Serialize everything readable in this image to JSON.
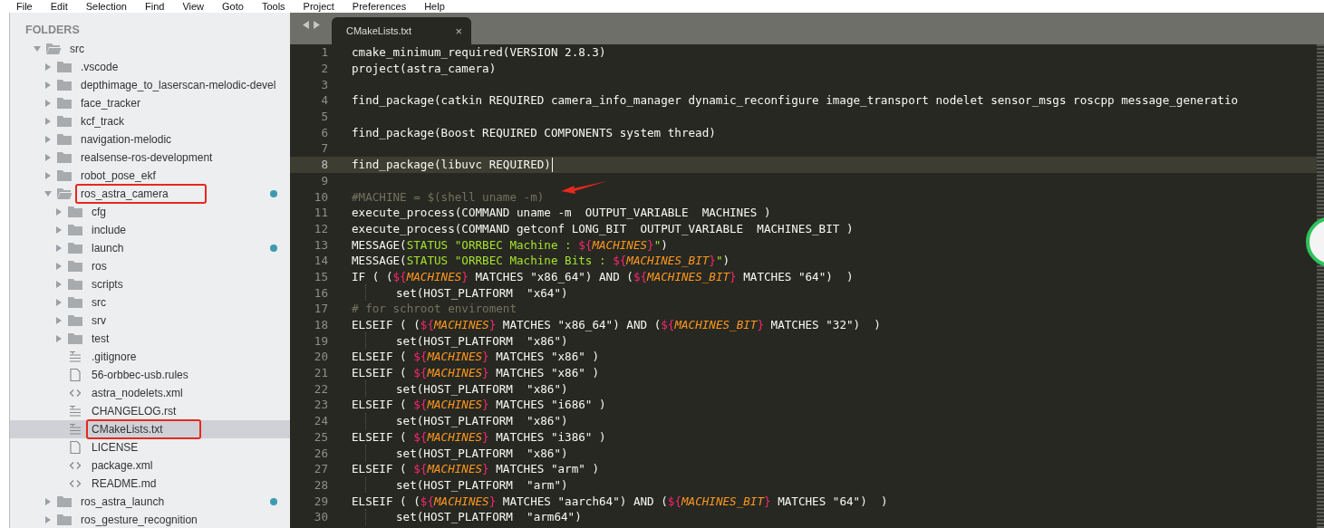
{
  "menu": [
    "File",
    "Edit",
    "Selection",
    "Find",
    "View",
    "Goto",
    "Tools",
    "Project",
    "Preferences",
    "Help"
  ],
  "sidebar": {
    "title": "FOLDERS",
    "tree": [
      {
        "name": "src",
        "kind": "folder",
        "expanded": true,
        "selected": false,
        "modified": false,
        "annotated": false,
        "children": [
          {
            "name": ".vscode",
            "kind": "folder",
            "expanded": false,
            "selected": false,
            "modified": false,
            "annotated": false
          },
          {
            "name": "depthimage_to_laserscan-melodic-devel",
            "kind": "folder",
            "expanded": false,
            "selected": false,
            "modified": false,
            "annotated": false
          },
          {
            "name": "face_tracker",
            "kind": "folder",
            "expanded": false,
            "selected": false,
            "modified": false,
            "annotated": false
          },
          {
            "name": "kcf_track",
            "kind": "folder",
            "expanded": false,
            "selected": false,
            "modified": false,
            "annotated": false
          },
          {
            "name": "navigation-melodic",
            "kind": "folder",
            "expanded": false,
            "selected": false,
            "modified": false,
            "annotated": false
          },
          {
            "name": "realsense-ros-development",
            "kind": "folder",
            "expanded": false,
            "selected": false,
            "modified": false,
            "annotated": false
          },
          {
            "name": "robot_pose_ekf",
            "kind": "folder",
            "expanded": false,
            "selected": false,
            "modified": false,
            "annotated": false
          },
          {
            "name": "ros_astra_camera",
            "kind": "folder",
            "expanded": true,
            "selected": false,
            "modified": true,
            "annotated": true,
            "children": [
              {
                "name": "cfg",
                "kind": "folder",
                "expanded": false,
                "selected": false,
                "modified": false,
                "annotated": false
              },
              {
                "name": "include",
                "kind": "folder",
                "expanded": false,
                "selected": false,
                "modified": false,
                "annotated": false
              },
              {
                "name": "launch",
                "kind": "folder",
                "expanded": false,
                "selected": false,
                "modified": true,
                "annotated": false
              },
              {
                "name": "ros",
                "kind": "folder",
                "expanded": false,
                "selected": false,
                "modified": false,
                "annotated": false
              },
              {
                "name": "scripts",
                "kind": "folder",
                "expanded": false,
                "selected": false,
                "modified": false,
                "annotated": false
              },
              {
                "name": "src",
                "kind": "folder",
                "expanded": false,
                "selected": false,
                "modified": false,
                "annotated": false
              },
              {
                "name": "srv",
                "kind": "folder",
                "expanded": false,
                "selected": false,
                "modified": false,
                "annotated": false
              },
              {
                "name": "test",
                "kind": "folder",
                "expanded": false,
                "selected": false,
                "modified": false,
                "annotated": false
              },
              {
                "name": ".gitignore",
                "kind": "text",
                "selected": false,
                "modified": false,
                "annotated": false
              },
              {
                "name": "56-orbbec-usb.rules",
                "kind": "doc",
                "selected": false,
                "modified": false,
                "annotated": false
              },
              {
                "name": "astra_nodelets.xml",
                "kind": "code",
                "selected": false,
                "modified": false,
                "annotated": false
              },
              {
                "name": "CHANGELOG.rst",
                "kind": "text",
                "selected": false,
                "modified": false,
                "annotated": false
              },
              {
                "name": "CMakeLists.txt",
                "kind": "text",
                "selected": true,
                "modified": false,
                "annotated": true
              },
              {
                "name": "LICENSE",
                "kind": "doc",
                "selected": false,
                "modified": false,
                "annotated": false
              },
              {
                "name": "package.xml",
                "kind": "code",
                "selected": false,
                "modified": false,
                "annotated": false
              },
              {
                "name": "README.md",
                "kind": "code",
                "selected": false,
                "modified": false,
                "annotated": false
              }
            ]
          },
          {
            "name": "ros_astra_launch",
            "kind": "folder",
            "expanded": false,
            "selected": false,
            "modified": true,
            "annotated": false
          },
          {
            "name": "ros_gesture_recognition",
            "kind": "folder",
            "expanded": false,
            "selected": false,
            "modified": false,
            "annotated": false
          }
        ]
      }
    ]
  },
  "tabs": [
    {
      "label": "CMakeLists.txt",
      "close": "×",
      "selected": true
    }
  ],
  "editor": {
    "lines": [
      {
        "num": "1",
        "current": false,
        "indented": false,
        "tokens": [
          {
            "kind": "plain",
            "text": "cmake_minimum_required(VERSION 2.8.3)"
          }
        ]
      },
      {
        "num": "2",
        "current": false,
        "indented": false,
        "tokens": [
          {
            "kind": "plain",
            "text": "project(astra_camera)"
          }
        ]
      },
      {
        "num": "3",
        "current": false,
        "indented": false
      },
      {
        "num": "4",
        "current": false,
        "indented": false,
        "tokens": [
          {
            "kind": "plain",
            "text": "find_package(catkin REQUIRED camera_info_manager dynamic_reconfigure image_transport nodelet sensor_msgs roscpp message_generatio"
          }
        ]
      },
      {
        "num": "5",
        "current": false,
        "indented": false
      },
      {
        "num": "6",
        "current": false,
        "indented": false,
        "tokens": [
          {
            "kind": "plain",
            "text": "find_package(Boost REQUIRED COMPONENTS system thread)"
          }
        ]
      },
      {
        "num": "7",
        "current": false,
        "indented": false
      },
      {
        "num": "8",
        "current": true,
        "indented": false,
        "tokens": [
          {
            "kind": "plain",
            "text": "find_package(libuvc REQUIRED)"
          }
        ]
      },
      {
        "num": "9",
        "current": false,
        "indented": false
      },
      {
        "num": "10",
        "current": false,
        "indented": false,
        "tokens": [
          {
            "kind": "comment",
            "text": "#MACHINE = $(shell uname -m)"
          }
        ]
      },
      {
        "num": "11",
        "current": false,
        "indented": false,
        "tokens": [
          {
            "kind": "plain",
            "text": "execute_process(COMMAND uname -m  OUTPUT_VARIABLE  MACHINES )"
          }
        ]
      },
      {
        "num": "12",
        "current": false,
        "indented": false,
        "tokens": [
          {
            "kind": "plain",
            "text": "execute_process(COMMAND getconf LONG_BIT  OUTPUT_VARIABLE  MACHINES_BIT )"
          }
        ]
      },
      {
        "num": "13",
        "current": false,
        "indented": false,
        "tokens": [
          {
            "kind": "plain",
            "text": "MESSAGE("
          },
          {
            "kind": "string",
            "text": "STATUS \"ORRBEC Machine : "
          },
          {
            "kind": "punct",
            "text": "${"
          },
          {
            "kind": "var",
            "text": "MACHINES"
          },
          {
            "kind": "punct",
            "text": "}"
          },
          {
            "kind": "string",
            "text": "\""
          },
          {
            "kind": "plain",
            "text": ")"
          }
        ]
      },
      {
        "num": "14",
        "current": false,
        "indented": false,
        "tokens": [
          {
            "kind": "plain",
            "text": "MESSAGE("
          },
          {
            "kind": "string",
            "text": "STATUS \"ORRBEC Machine Bits : "
          },
          {
            "kind": "punct",
            "text": "${"
          },
          {
            "kind": "var",
            "text": "MACHINES_BIT"
          },
          {
            "kind": "punct",
            "text": "}"
          },
          {
            "kind": "string",
            "text": "\""
          },
          {
            "kind": "plain",
            "text": ")"
          }
        ]
      },
      {
        "num": "15",
        "current": false,
        "indented": false,
        "tokens": [
          {
            "kind": "plain",
            "text": "IF ( ("
          },
          {
            "kind": "punct",
            "text": "${"
          },
          {
            "kind": "var",
            "text": "MACHINES"
          },
          {
            "kind": "punct",
            "text": "}"
          },
          {
            "kind": "plain",
            "text": " MATCHES \"x86_64\") AND ("
          },
          {
            "kind": "punct",
            "text": "${"
          },
          {
            "kind": "var",
            "text": "MACHINES_BIT"
          },
          {
            "kind": "punct",
            "text": "}"
          },
          {
            "kind": "plain",
            "text": " MATCHES \"64\")  )"
          }
        ]
      },
      {
        "num": "16",
        "current": false,
        "indented": true,
        "tokens": [
          {
            "kind": "plain",
            "text": "set(HOST_PLATFORM  \"x64\")"
          }
        ]
      },
      {
        "num": "17",
        "current": false,
        "indented": false,
        "tokens": [
          {
            "kind": "comment",
            "text": "# for schroot enviroment"
          }
        ]
      },
      {
        "num": "18",
        "current": false,
        "indented": false,
        "tokens": [
          {
            "kind": "plain",
            "text": "ELSEIF ( ("
          },
          {
            "kind": "punct",
            "text": "${"
          },
          {
            "kind": "var",
            "text": "MACHINES"
          },
          {
            "kind": "punct",
            "text": "}"
          },
          {
            "kind": "plain",
            "text": " MATCHES \"x86_64\") AND ("
          },
          {
            "kind": "punct",
            "text": "${"
          },
          {
            "kind": "var",
            "text": "MACHINES_BIT"
          },
          {
            "kind": "punct",
            "text": "}"
          },
          {
            "kind": "plain",
            "text": " MATCHES \"32\")  )"
          }
        ]
      },
      {
        "num": "19",
        "current": false,
        "indented": true,
        "tokens": [
          {
            "kind": "plain",
            "text": "set(HOST_PLATFORM  \"x86\")"
          }
        ]
      },
      {
        "num": "20",
        "current": false,
        "indented": false,
        "tokens": [
          {
            "kind": "plain",
            "text": "ELSEIF ( "
          },
          {
            "kind": "punct",
            "text": "${"
          },
          {
            "kind": "var",
            "text": "MACHINES"
          },
          {
            "kind": "punct",
            "text": "}"
          },
          {
            "kind": "plain",
            "text": " MATCHES \"x86\" )"
          }
        ]
      },
      {
        "num": "21",
        "current": false,
        "indented": false,
        "tokens": [
          {
            "kind": "plain",
            "text": "ELSEIF ( "
          },
          {
            "kind": "punct",
            "text": "${"
          },
          {
            "kind": "var",
            "text": "MACHINES"
          },
          {
            "kind": "punct",
            "text": "}"
          },
          {
            "kind": "plain",
            "text": " MATCHES \"x86\" )"
          }
        ]
      },
      {
        "num": "22",
        "current": false,
        "indented": true,
        "tokens": [
          {
            "kind": "plain",
            "text": "set(HOST_PLATFORM  \"x86\")"
          }
        ]
      },
      {
        "num": "23",
        "current": false,
        "indented": false,
        "tokens": [
          {
            "kind": "plain",
            "text": "ELSEIF ( "
          },
          {
            "kind": "punct",
            "text": "${"
          },
          {
            "kind": "var",
            "text": "MACHINES"
          },
          {
            "kind": "punct",
            "text": "}"
          },
          {
            "kind": "plain",
            "text": " MATCHES \"i686\" )"
          }
        ]
      },
      {
        "num": "24",
        "current": false,
        "indented": true,
        "tokens": [
          {
            "kind": "plain",
            "text": "set(HOST_PLATFORM  \"x86\")"
          }
        ]
      },
      {
        "num": "25",
        "current": false,
        "indented": false,
        "tokens": [
          {
            "kind": "plain",
            "text": "ELSEIF ( "
          },
          {
            "kind": "punct",
            "text": "${"
          },
          {
            "kind": "var",
            "text": "MACHINES"
          },
          {
            "kind": "punct",
            "text": "}"
          },
          {
            "kind": "plain",
            "text": " MATCHES \"i386\" )"
          }
        ]
      },
      {
        "num": "26",
        "current": false,
        "indented": true,
        "tokens": [
          {
            "kind": "plain",
            "text": "set(HOST_PLATFORM  \"x86\")"
          }
        ]
      },
      {
        "num": "27",
        "current": false,
        "indented": false,
        "tokens": [
          {
            "kind": "plain",
            "text": "ELSEIF ( "
          },
          {
            "kind": "punct",
            "text": "${"
          },
          {
            "kind": "var",
            "text": "MACHINES"
          },
          {
            "kind": "punct",
            "text": "}"
          },
          {
            "kind": "plain",
            "text": " MATCHES \"arm\" )"
          }
        ]
      },
      {
        "num": "28",
        "current": false,
        "indented": true,
        "tokens": [
          {
            "kind": "plain",
            "text": "set(HOST_PLATFORM  \"arm\")"
          }
        ]
      },
      {
        "num": "29",
        "current": false,
        "indented": false,
        "tokens": [
          {
            "kind": "plain",
            "text": "ELSEIF ( ("
          },
          {
            "kind": "punct",
            "text": "${"
          },
          {
            "kind": "var",
            "text": "MACHINES"
          },
          {
            "kind": "punct",
            "text": "}"
          },
          {
            "kind": "plain",
            "text": " MATCHES \"aarch64\") AND ("
          },
          {
            "kind": "punct",
            "text": "${"
          },
          {
            "kind": "var",
            "text": "MACHINES_BIT"
          },
          {
            "kind": "punct",
            "text": "}"
          },
          {
            "kind": "plain",
            "text": " MATCHES \"64\")  )"
          }
        ]
      },
      {
        "num": "30",
        "current": false,
        "indented": true,
        "tokens": [
          {
            "kind": "plain",
            "text": "set(HOST_PLATFORM  \"arm64\")"
          }
        ]
      }
    ]
  }
}
